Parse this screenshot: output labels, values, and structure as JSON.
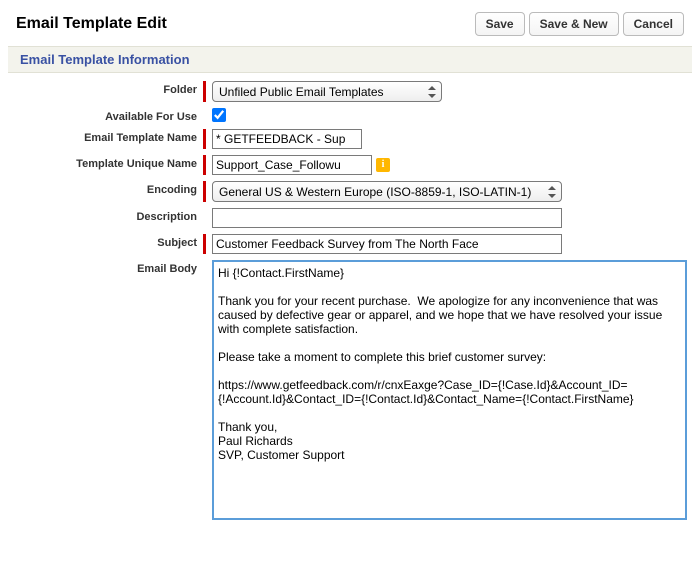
{
  "header": {
    "title": "Email Template Edit",
    "save_label": "Save",
    "save_new_label": "Save & New",
    "cancel_label": "Cancel"
  },
  "section_title": "Email Template Information",
  "fields": {
    "folder_label": "Folder",
    "folder_value": "Unfiled Public Email Templates",
    "available_label": "Available For Use",
    "available_checked": true,
    "name_label": "Email Template Name",
    "name_value": "* GETFEEDBACK - Sup",
    "unique_label": "Template Unique Name",
    "unique_value": "Support_Case_Followu",
    "encoding_label": "Encoding",
    "encoding_value": "General US & Western Europe (ISO-8859-1, ISO-LATIN-1)",
    "description_label": "Description",
    "description_value": "",
    "subject_label": "Subject",
    "subject_value": "Customer Feedback Survey from The North Face",
    "body_label": "Email Body",
    "body_value": "Hi {!Contact.FirstName}\n\nThank you for your recent purchase.  We apologize for any inconvenience that was caused by defective gear or apparel, and we hope that we have resolved your issue with complete satisfaction.\n\nPlease take a moment to complete this brief customer survey:\n\nhttps://www.getfeedback.com/r/cnxEaxge?Case_ID={!Case.Id}&Account_ID={!Account.Id}&Contact_ID={!Contact.Id}&Contact_Name={!Contact.FirstName}\n\nThank you,\nPaul Richards\nSVP, Customer Support"
  },
  "help_icon_text": "i"
}
